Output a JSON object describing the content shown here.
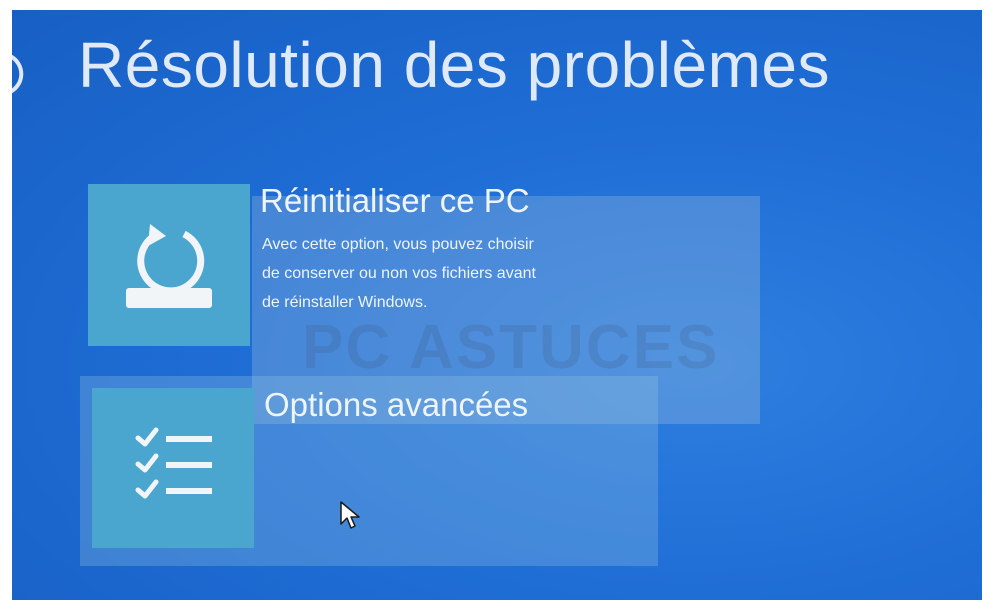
{
  "page": {
    "title": "Résolution des problèmes",
    "back_icon": "back-arrow-icon"
  },
  "options": [
    {
      "title": "Réinitialiser ce PC",
      "description": [
        "Avec cette option, vous pouvez choisir",
        "de conserver ou non vos fichiers avant",
        "de réinstaller Windows."
      ],
      "icon": "reset-pc-icon"
    },
    {
      "title": "Options avancées",
      "icon": "checklist-icon"
    }
  ],
  "watermark": "PC ASTUCES",
  "colors": {
    "background": "#1f6ed6",
    "tile": "#4aa6cf",
    "text": "#eef4fb"
  }
}
